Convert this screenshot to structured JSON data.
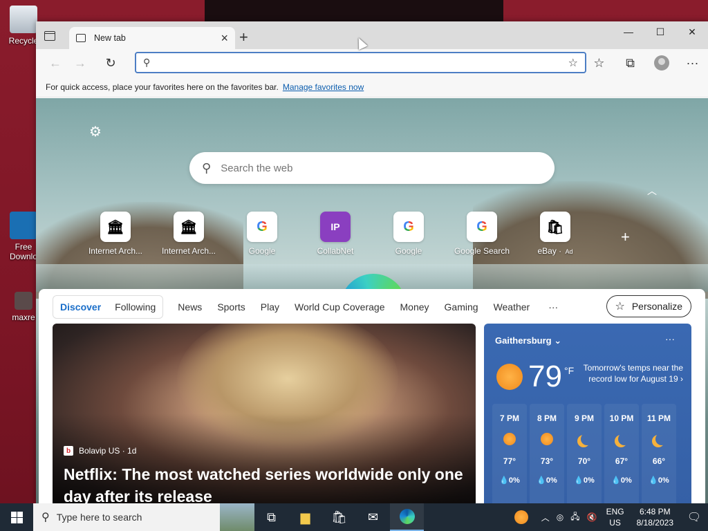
{
  "desktop": {
    "icons": [
      {
        "label": "Recycle"
      },
      {
        "label": "Free Downlo"
      },
      {
        "label": "maxre"
      }
    ]
  },
  "browser": {
    "tab": {
      "title": "New tab"
    },
    "address": {
      "value": ""
    },
    "favbar": {
      "message": "For quick access, place your favorites here on the favorites bar.",
      "link": "Manage favorites now"
    }
  },
  "ntp": {
    "search_placeholder": "Search the web",
    "quick_links": [
      {
        "label": "Internet Arch...",
        "icon": "archive-icon",
        "glyph": "🏛"
      },
      {
        "label": "Internet Arch...",
        "icon": "archive-icon",
        "glyph": "🏛"
      },
      {
        "label": "Google",
        "icon": "google-icon",
        "glyph": "G"
      },
      {
        "label": "CollabNet",
        "icon": "collabnet-icon",
        "glyph": "IP"
      },
      {
        "label": "Google",
        "icon": "google-icon",
        "glyph": "G"
      },
      {
        "label": "Google Search",
        "icon": "google-icon",
        "glyph": "G"
      },
      {
        "label": "eBay",
        "ad": "Ad",
        "icon": "ebay-icon",
        "glyph": "🛍"
      }
    ]
  },
  "feed": {
    "segments": [
      "Discover",
      "Following"
    ],
    "nav": [
      "News",
      "Sports",
      "Play",
      "World Cup Coverage",
      "Money",
      "Gaming",
      "Weather"
    ],
    "more": "···",
    "personalize": "Personalize",
    "hero": {
      "source": "Bolavip US · 1d",
      "title": "Netflix: The most watched series worldwide only one day after its release"
    }
  },
  "weather": {
    "location": "Gaithersburg",
    "more": "···",
    "temp": "79",
    "unit": "°F",
    "note": "Tomorrow's temps near the record low for August 19",
    "hourly": [
      {
        "time": "7 PM",
        "icon": "sun",
        "temp": "77°",
        "precip": "0%"
      },
      {
        "time": "8 PM",
        "icon": "sun",
        "temp": "73°",
        "precip": "0%"
      },
      {
        "time": "9 PM",
        "icon": "moon",
        "temp": "70°",
        "precip": "0%"
      },
      {
        "time": "10 PM",
        "icon": "moon",
        "temp": "67°",
        "precip": "0%"
      },
      {
        "time": "11 PM",
        "icon": "moon",
        "temp": "66°",
        "precip": "0%"
      }
    ]
  },
  "taskbar": {
    "search_placeholder": "Type here to search",
    "lang_top": "ENG",
    "lang_bottom": "US",
    "time": "6:48 PM",
    "date": "8/18/2023"
  }
}
